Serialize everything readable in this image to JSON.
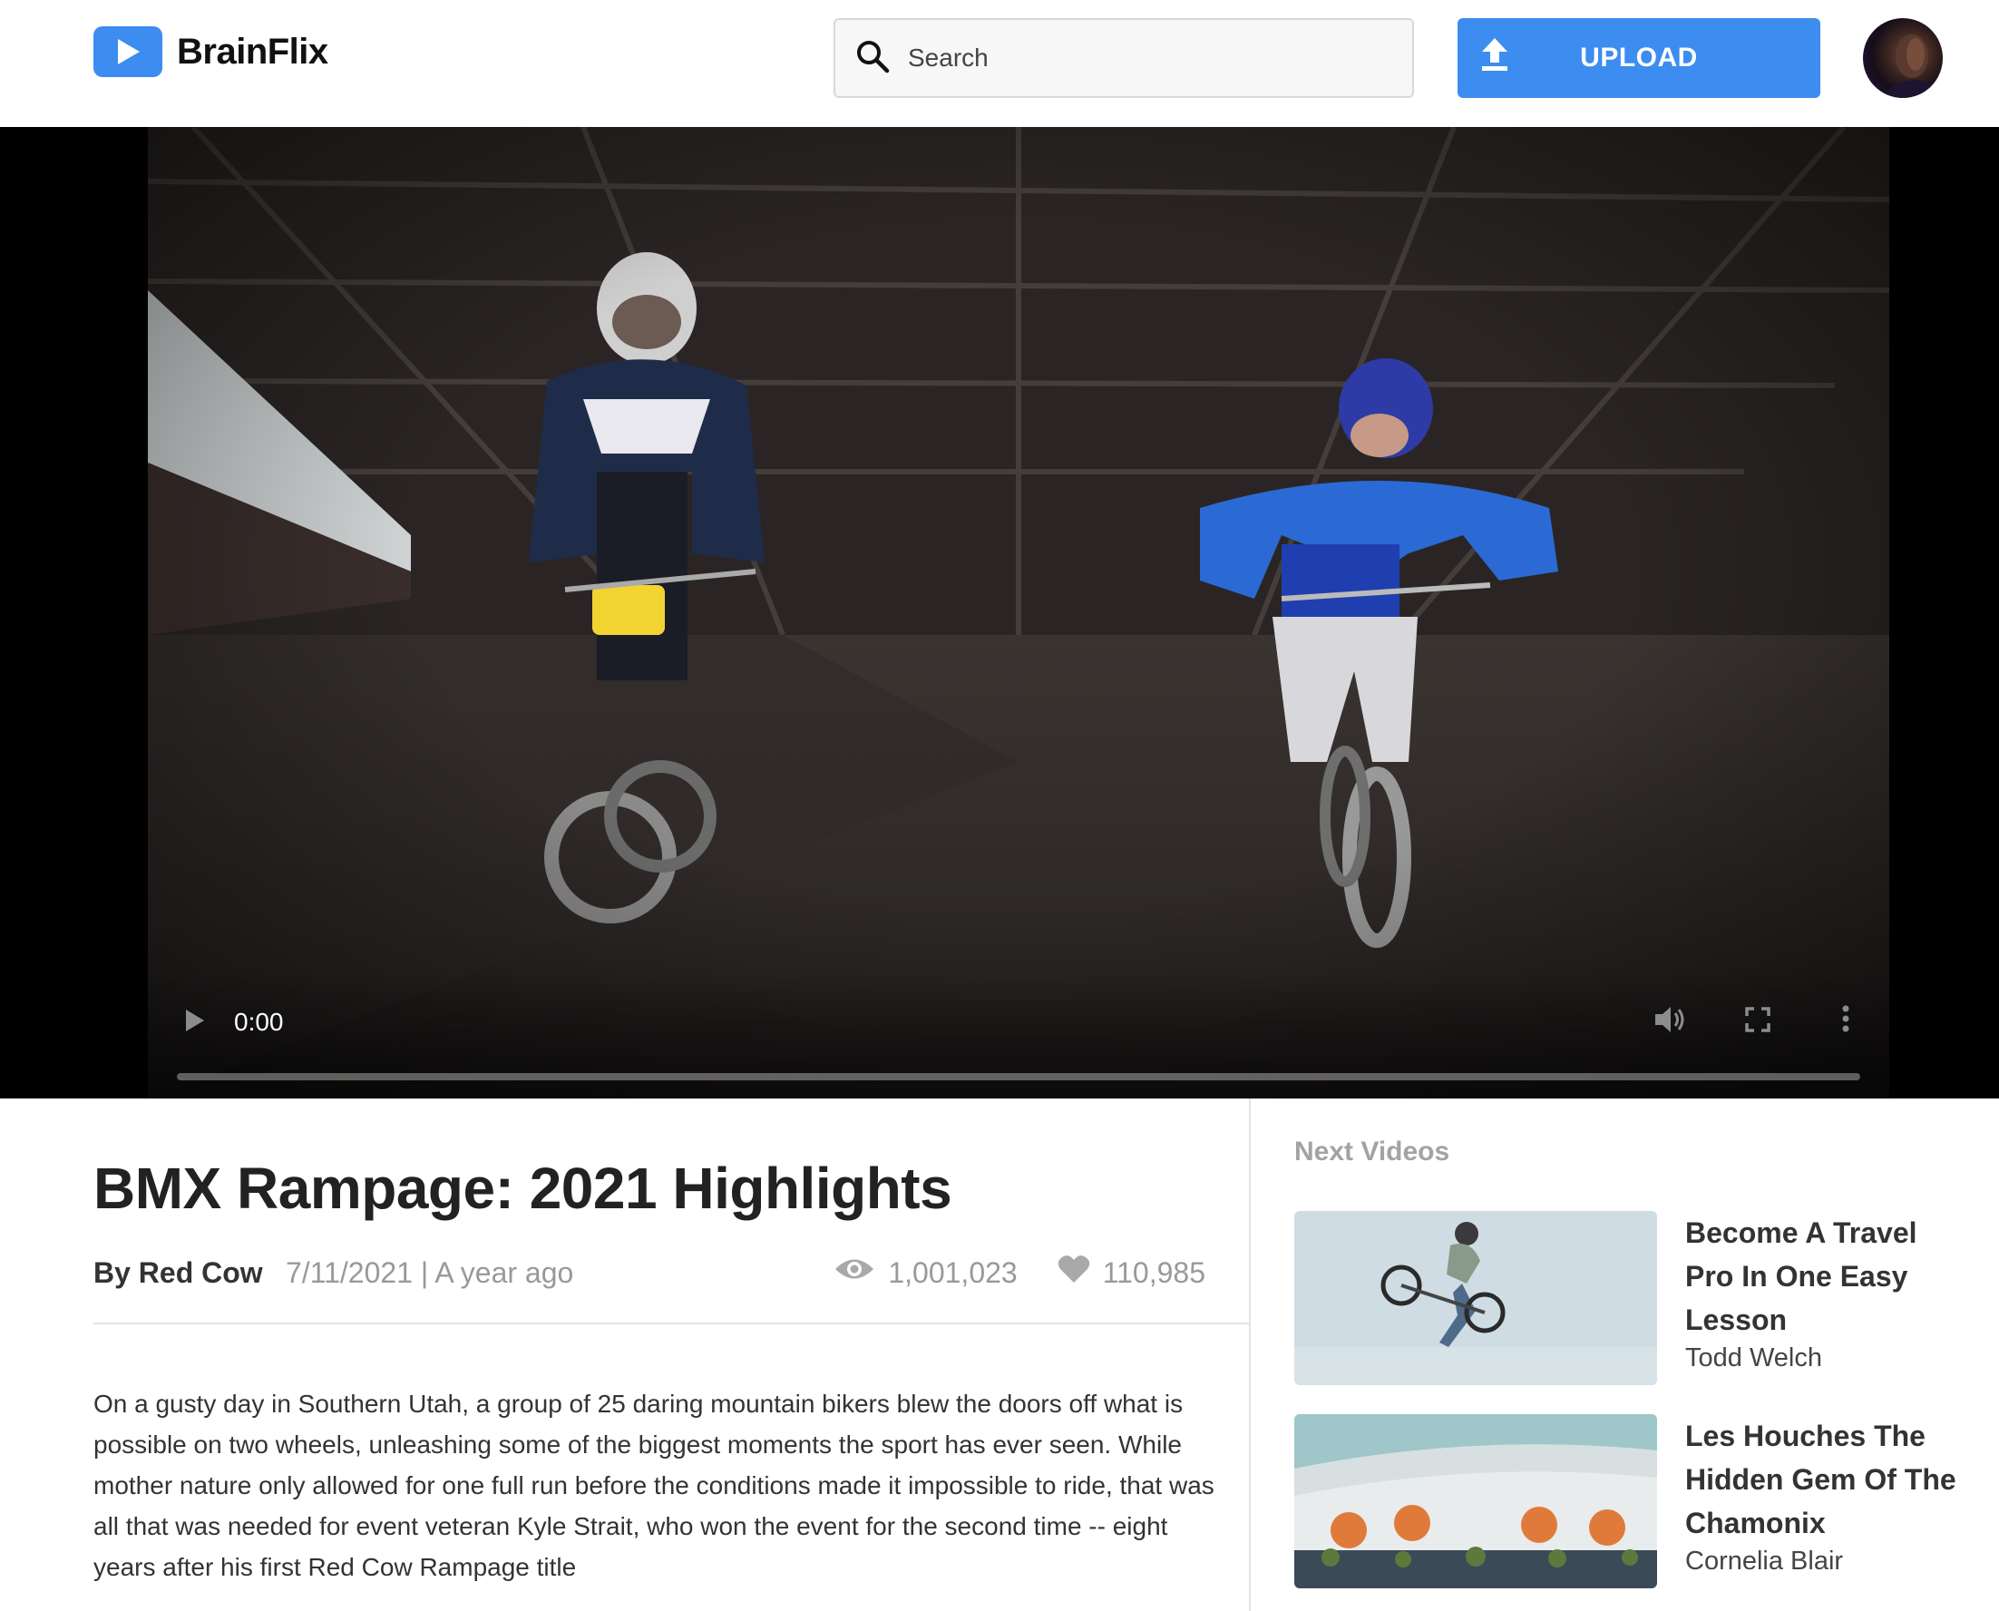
{
  "header": {
    "logo_text": "BrainFlix",
    "search_placeholder": "Search",
    "upload_label": "UPLOAD"
  },
  "video": {
    "current_time": "0:00",
    "progress": 0
  },
  "main": {
    "title": "BMX Rampage: 2021 Highlights",
    "author": "By Red Cow",
    "date": "7/11/2021 | A year ago",
    "views": "1,001,023",
    "likes": "110,985",
    "description": "On a gusty day in Southern Utah, a group of 25 daring mountain bikers blew the doors off what is possible on two wheels, unleashing some of the biggest moments the sport has ever seen. While mother nature only allowed for one full run before the conditions made it impossible to ride, that was all that was needed for event veteran Kyle Strait, who won the event for the second time -- eight years after his first Red Cow Rampage title"
  },
  "sidebar": {
    "heading": "Next Videos",
    "videos": [
      {
        "title": "Become A Travel Pro In One Easy Lesson",
        "author": "Todd Welch"
      },
      {
        "title": "Les Houches The Hidden Gem Of The Chamonix",
        "author": "Cornelia Blair"
      }
    ]
  },
  "colors": {
    "accent": "#3d8cf0",
    "muted_text": "#999999",
    "heading_text": "#222222"
  }
}
